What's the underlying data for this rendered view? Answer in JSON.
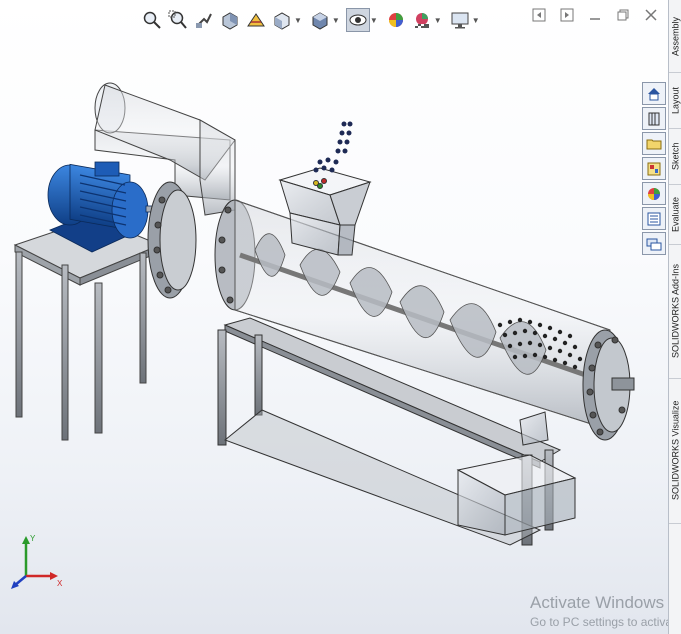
{
  "task_pane_tabs": [
    "SOLIDWORKS Visualize",
    "SOLIDWORKS Add-Ins",
    "Evaluate",
    "Sketch",
    "Layout",
    "Assembly"
  ],
  "triad": {
    "x_label": "X",
    "y_label": "Y"
  },
  "watermark": {
    "title": "Activate Windows",
    "subtitle": "Go to PC settings to activate Windows."
  },
  "colors": {
    "motor_blue": "#1f5fb3",
    "steel": "#8a8f96",
    "glass": "#c9ced6",
    "background": "#ffffff"
  }
}
